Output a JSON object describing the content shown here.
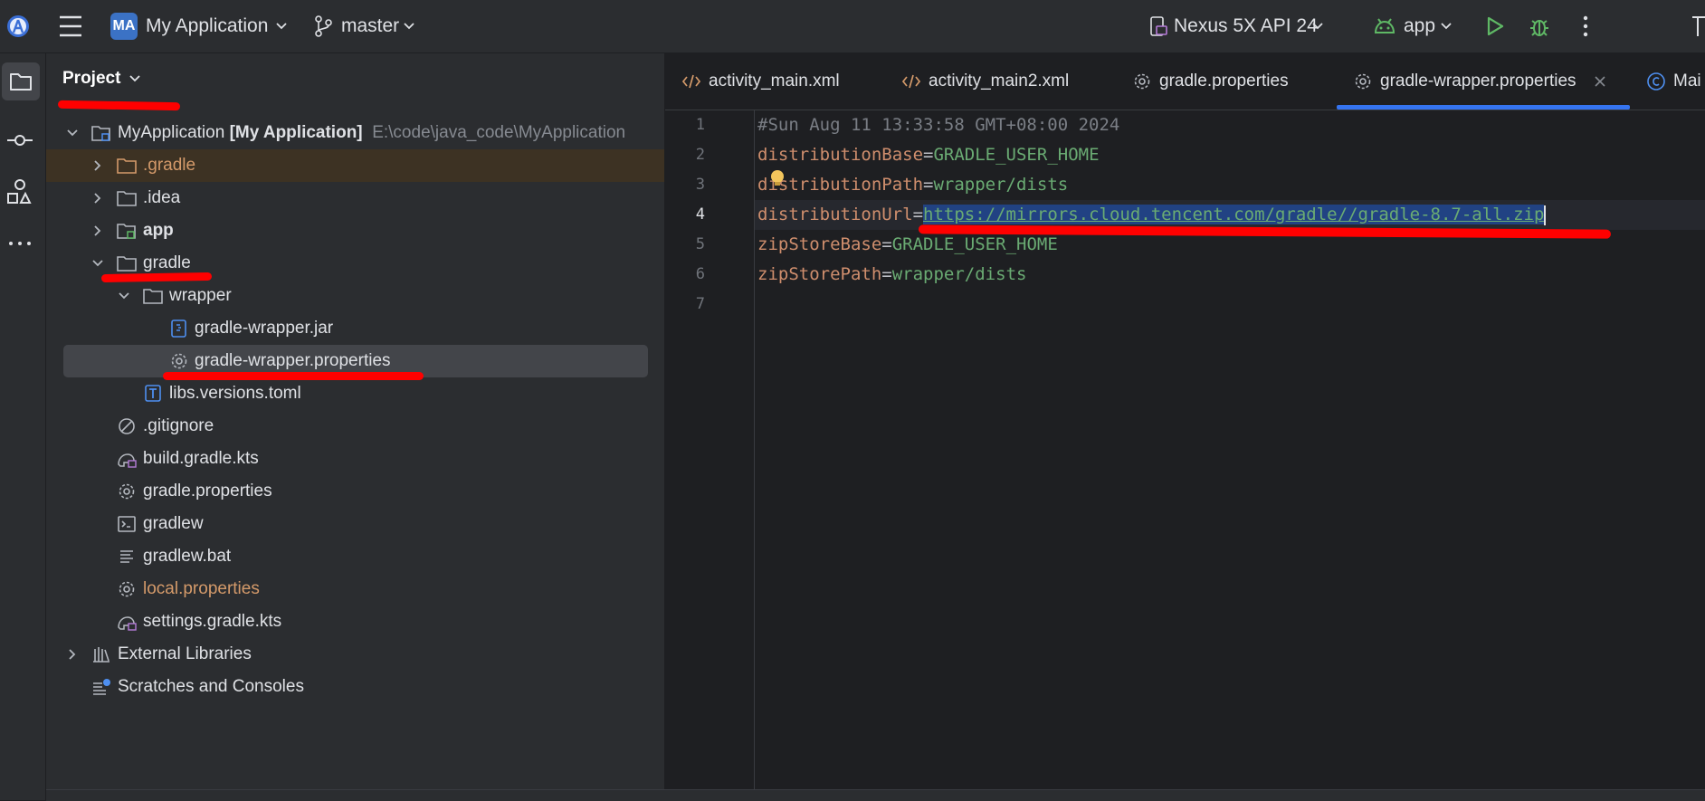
{
  "topbar": {
    "project_badge": "MA",
    "project_name": "My Application",
    "branch": "master",
    "device": "Nexus 5X API 24",
    "run_config": "app"
  },
  "panel": {
    "title": "Project"
  },
  "tree": {
    "root_name": "MyApplication",
    "root_module": "[My Application]",
    "root_path": "E:\\code\\java_code\\MyApplication",
    "items": [
      {
        "label": ".gradle"
      },
      {
        "label": ".idea"
      },
      {
        "label": "app"
      },
      {
        "label": "gradle"
      },
      {
        "label": "wrapper"
      },
      {
        "label": "gradle-wrapper.jar"
      },
      {
        "label": "gradle-wrapper.properties"
      },
      {
        "label": "libs.versions.toml"
      },
      {
        "label": ".gitignore"
      },
      {
        "label": "build.gradle.kts"
      },
      {
        "label": "gradle.properties"
      },
      {
        "label": "gradlew"
      },
      {
        "label": "gradlew.bat"
      },
      {
        "label": "local.properties"
      },
      {
        "label": "settings.gradle.kts"
      },
      {
        "label": "External Libraries"
      },
      {
        "label": "Scratches and Consoles"
      }
    ]
  },
  "tabs": [
    {
      "label": "activity_main.xml"
    },
    {
      "label": "activity_main2.xml"
    },
    {
      "label": "gradle.properties"
    },
    {
      "label": "gradle-wrapper.properties",
      "active": true
    },
    {
      "label": "Mai"
    }
  ],
  "editor": {
    "line_numbers": [
      "1",
      "2",
      "3",
      "4",
      "5",
      "6",
      "7"
    ],
    "comment": "#Sun Aug 11 13:33:58 GMT+08:00 2024",
    "lines": [
      {
        "key": "distributionBase",
        "value": "GRADLE_USER_HOME"
      },
      {
        "key": "distributionPath",
        "value": "wrapper/dists"
      },
      {
        "key": "distributionUrl",
        "value": "https://mirrors.cloud.tencent.com/gradle//gradle-8.7-all.zip"
      },
      {
        "key": "zipStoreBase",
        "value": "GRADLE_USER_HOME"
      },
      {
        "key": "zipStorePath",
        "value": "wrapper/dists"
      }
    ]
  },
  "colors": {
    "accent": "#3574f0",
    "annotation": "#ff0000",
    "selection": "#2e436e"
  }
}
